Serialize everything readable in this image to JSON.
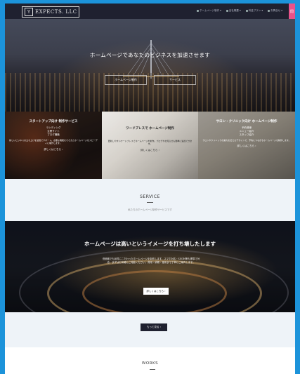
{
  "header": {
    "logo_text": "EXPECTS. LLC",
    "nav": [
      "ホームページ制作 ▾",
      "会社概要 ▾",
      "料金プラン ▾",
      "お問合せ ▾"
    ],
    "contact_tab": "問"
  },
  "hero": {
    "title": "ホームページであなたのビジネスを加速させます",
    "button_1": "ホームページ制作",
    "button_2": "サービス"
  },
  "cards": [
    {
      "title": "スタートアップ向け 制作サービス",
      "list": [
        "ランディング",
        "企業サイト",
        "ブログ構築"
      ],
      "desc": "新しいビジネスの立ち上げを最短でサポート。必要な機能をそろえたホームページをスピーディに制作します。",
      "link": "詳しくはこちら ›"
    },
    {
      "title": "ワードプレスで ホームページ制作",
      "list": [],
      "desc": "更新しやすいワードプレスでホームページを制作。ブログやお知らせも簡単に追加できます。",
      "link": "詳しくはこちら ›"
    },
    {
      "title": "サロン・クリニック向け ホームページ制作",
      "list": [
        "予約導線",
        "メニュー紹介",
        "スタッフ紹介"
      ],
      "desc": "サロンやクリニックの魅力を伝えるデザインで、予約につながるホームページを制作します。",
      "link": "詳しくはこちら ›"
    }
  ],
  "service": {
    "title": "SERVICE",
    "subtitle": "私たちのホームページ制作サービスです"
  },
  "banner": {
    "title": "ホームページは高いというイメージを打ち壊したします",
    "body": "低価格でも品質にこだわったホームページを制作します。スマホ対応・SEO対策も標準で対応。まずはお気軽にご相談ください。費用・納期・運用まで丁寧にご案内します。",
    "button": "詳しくはこちら ›"
  },
  "more_button": "もっと見る ›",
  "works": {
    "title": "WORKS"
  }
}
